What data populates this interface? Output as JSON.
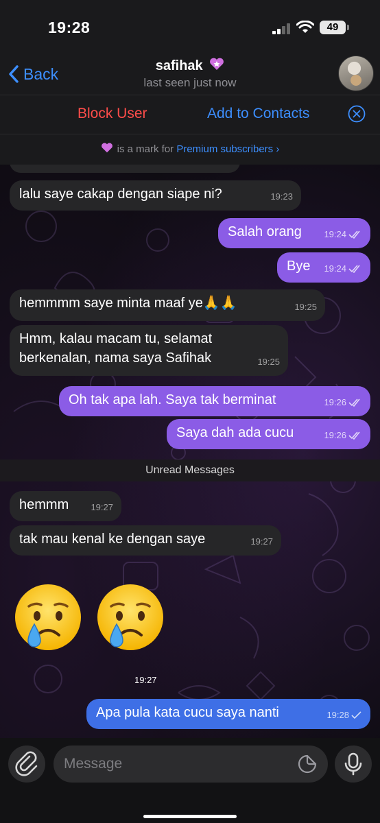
{
  "status_bar": {
    "time": "19:28",
    "battery": "49"
  },
  "header": {
    "back_label": "Back",
    "title": "safihak",
    "subtitle": "last seen just now"
  },
  "actions": {
    "block_label": "Block User",
    "add_label": "Add to Contacts"
  },
  "premium_notice": {
    "text": "is a mark for",
    "link": "Premium subscribers",
    "chevron": "›"
  },
  "messages": [
    {
      "dir": "in",
      "text": "lalu saye cakap dengan siape ni?",
      "time": "19:23"
    },
    {
      "dir": "out",
      "text": "Salah orang",
      "time": "19:24"
    },
    {
      "dir": "out",
      "text": "Bye",
      "time": "19:24"
    },
    {
      "dir": "in",
      "text": "hemmmm saye minta maaf ye🙏🙏",
      "time": "19:25"
    },
    {
      "dir": "in",
      "text": "Hmm, kalau macam tu, selamat",
      "text2": "berkenalan, nama saya Safihak",
      "time": "19:25"
    },
    {
      "dir": "out",
      "text": "Oh tak apa lah. Saya tak berminat",
      "time": "19:26"
    },
    {
      "dir": "out",
      "text": "Saya dah ada cucu",
      "time": "19:26"
    },
    {
      "dir": "in",
      "text": "hemmm",
      "time": "19:27"
    },
    {
      "dir": "in",
      "text": "tak mau kenal ke dengan saye",
      "time": "19:27"
    },
    {
      "dir": "in",
      "emoji": "crying-face-icon",
      "time": "19:27"
    },
    {
      "dir": "out",
      "text": "Apa pula kata cucu saya nanti",
      "time": "19:28"
    }
  ],
  "partial_time": "19:23",
  "unread_label": "Unread Messages",
  "input": {
    "placeholder": "Message"
  },
  "colors": {
    "accent_blue": "#3d8fff",
    "block_red": "#ff4d4a",
    "outgoing_purple": "#8b5ce6",
    "outgoing_blue": "#3e6fe6",
    "incoming": "#262628"
  },
  "icons": [
    "chevron-left-icon",
    "premium-heart-icon",
    "close-circle-icon",
    "double-check-icon",
    "single-check-icon",
    "paperclip-icon",
    "sticker-icon",
    "microphone-icon"
  ]
}
